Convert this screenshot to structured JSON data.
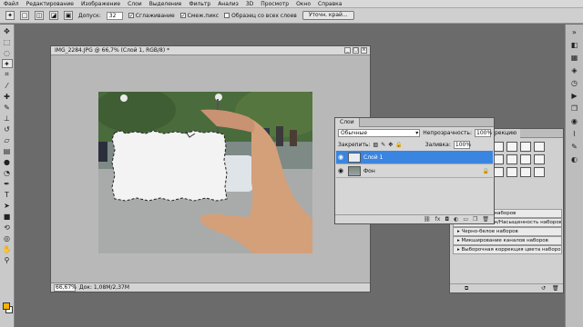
{
  "menu": [
    "Файл",
    "Редактирование",
    "Изображение",
    "Слои",
    "Выделение",
    "Фильтр",
    "Анализ",
    "3D",
    "Просмотр",
    "Окно",
    "Справка"
  ],
  "options": {
    "tolerance_label": "Допуск:",
    "tolerance_value": "32",
    "antialias_label": "Сглаживание",
    "contiguous_label": "Смеж.пикс",
    "sample_all_label": "Образец со всех слоев",
    "refine_button": "Уточн. край..."
  },
  "document": {
    "title": "IMG_2284.JPG @ 66,7% (Слой 1, RGB/8) *",
    "zoom": "66,67%",
    "doc_size": "Док: 1,08M/2,37M"
  },
  "layers_panel": {
    "tab": "Слои",
    "blend_mode": "Обычные",
    "opacity_label": "Непрозрачность:",
    "opacity_value": "100%",
    "lock_label": "Закрепить:",
    "fill_label": "Заливка:",
    "fill_value": "100%",
    "layers": [
      {
        "name": "Слой 1",
        "active": true
      },
      {
        "name": "Фон",
        "active": false
      }
    ]
  },
  "adjustments_panel": {
    "tab_partial": "рекцию",
    "presets": [
      "Экспозиция наборов",
      "Цветовой тон/Насыщенность наборов",
      "Черно-белое наборов",
      "Микширование каналов наборов",
      "Выборочная коррекция цвета наборов"
    ]
  },
  "colors": {
    "foreground": "#f6b400",
    "background": "#ffffff",
    "layer_selected": "#3a85e0"
  }
}
